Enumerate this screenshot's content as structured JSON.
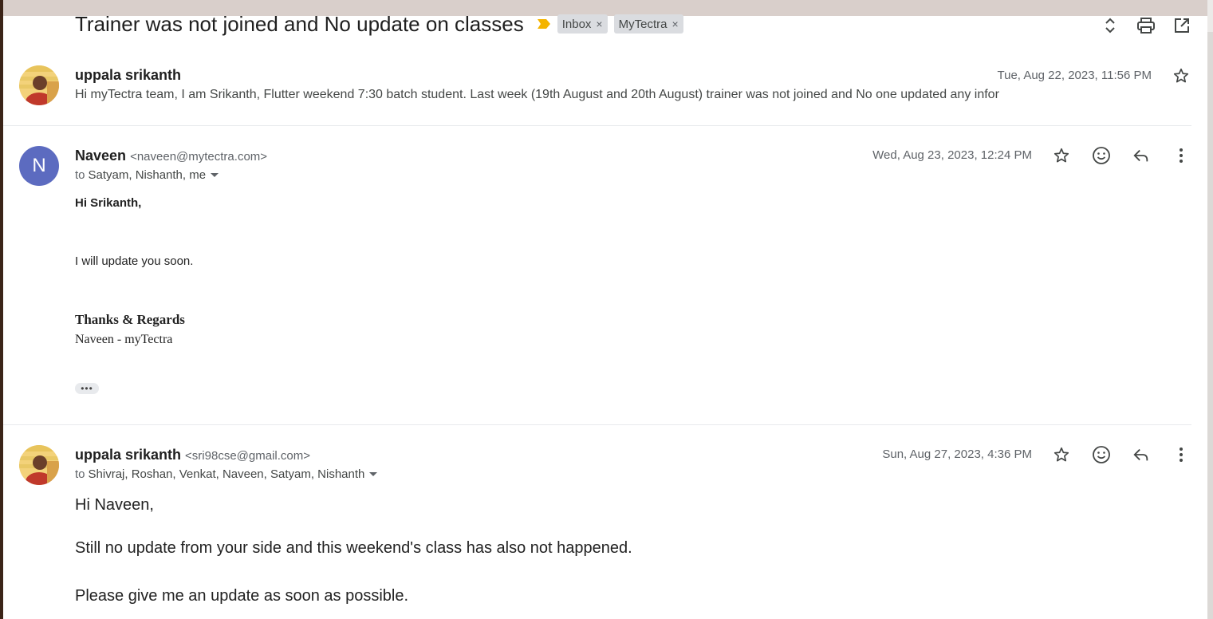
{
  "thread": {
    "subject": "Trainer was not joined and No update on classes",
    "labels": [
      {
        "name": "Inbox",
        "remove": "×"
      },
      {
        "name": "MyTectra",
        "remove": "×"
      }
    ]
  },
  "messages": [
    {
      "sender": "uppala srikanth",
      "date": "Tue, Aug 22, 2023, 11:56 PM",
      "snippet": "Hi myTectra team, I am Srikanth, Flutter weekend 7:30 batch student. Last week (19th August and 20th August) trainer was not joined and No one updated any infor"
    },
    {
      "sender": "Naveen",
      "email": "<naveen@mytectra.com>",
      "avatar_letter": "N",
      "to_prefix": "to",
      "to": "Satyam, Nishanth, me",
      "date": "Wed, Aug 23, 2023, 12:24 PM",
      "body": {
        "greeting": "Hi Srikanth,",
        "line1": "I will update you soon.",
        "sign_title": "Thanks & Regards",
        "sign_name": "Naveen - myTectra",
        "more": "•••"
      }
    },
    {
      "sender": "uppala srikanth",
      "email": "<sri98cse@gmail.com>",
      "to_prefix": "to",
      "to": "Shivraj, Roshan, Venkat, Naveen, Satyam, Nishanth",
      "date": "Sun, Aug 27, 2023, 4:36 PM",
      "body": {
        "greeting": "Hi Naveen,",
        "line1": "Still no update from your side and this weekend's class has also not happened.",
        "line2": "Please give me an update as soon as possible."
      }
    }
  ],
  "colors": {
    "important_marker": "#f4b400",
    "avatar_n": "#5c6bc0"
  }
}
